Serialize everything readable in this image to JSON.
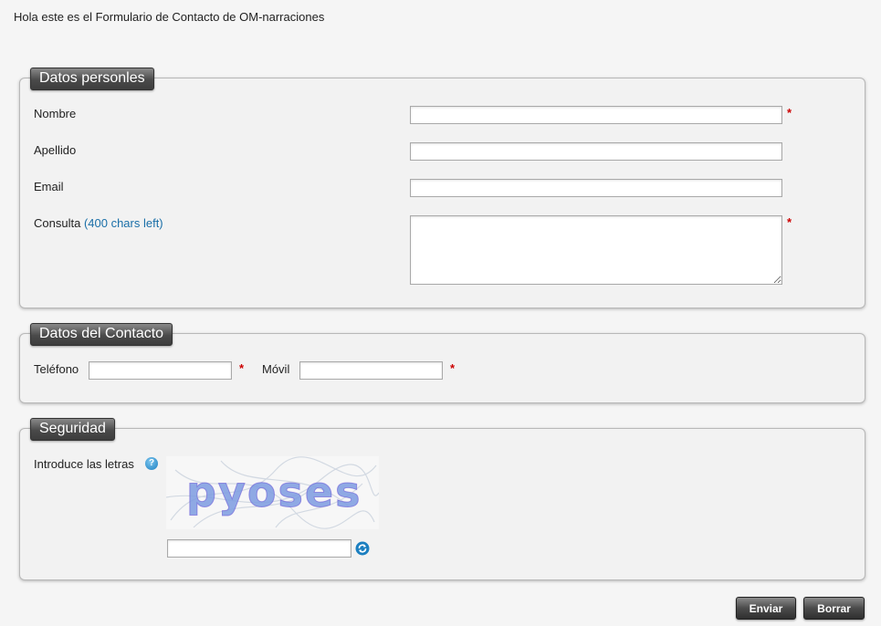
{
  "page": {
    "intro": "Hola este es el Formulario de Contacto de OM-narraciones"
  },
  "personal": {
    "legend": "Datos personles",
    "nombre_label": "Nombre",
    "apellido_label": "Apellido",
    "email_label": "Email",
    "consulta_label": "Consulta",
    "consulta_hint": "(400 chars left)",
    "required_mark": "*",
    "nombre_value": "",
    "apellido_value": "",
    "email_value": "",
    "consulta_value": ""
  },
  "contact": {
    "legend": "Datos del Contacto",
    "telefono_label": "Teléfono",
    "movil_label": "Móvil",
    "required_mark": "*",
    "telefono_value": "",
    "movil_value": ""
  },
  "security": {
    "legend": "Seguridad",
    "captcha_label": "Introduce las letras",
    "captcha_text": "pyoses",
    "captcha_value": "",
    "help_icon": "help-bubble-icon",
    "refresh_icon": "refresh-icon"
  },
  "actions": {
    "submit_label": "Enviar",
    "reset_label": "Borrar"
  },
  "colors": {
    "required": "#cc0000",
    "hint": "#1a6fa8",
    "legend_bg": "#4a4a4a"
  }
}
